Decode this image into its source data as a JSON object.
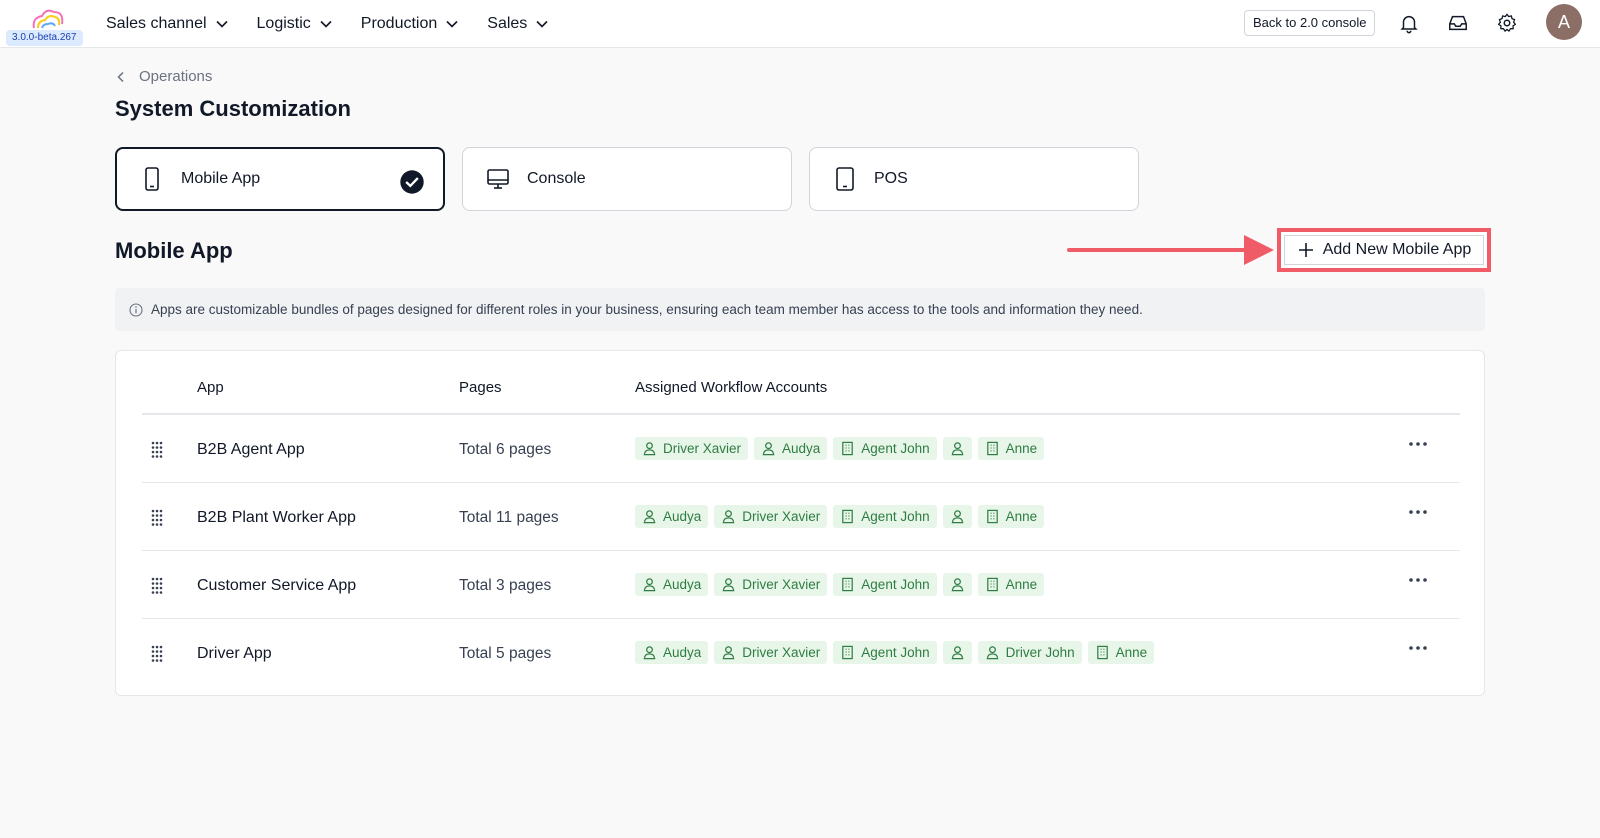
{
  "topbar": {
    "version": "3.0.0-beta.267",
    "nav": [
      {
        "label": "Sales channel"
      },
      {
        "label": "Logistic"
      },
      {
        "label": "Production"
      },
      {
        "label": "Sales"
      }
    ],
    "back_label": "Back to 2.0 console",
    "avatar_initial": "A"
  },
  "breadcrumb": {
    "label": "Operations"
  },
  "page_title": "System Customization",
  "types": [
    {
      "label": "Mobile App",
      "active": true
    },
    {
      "label": "Console",
      "active": false
    },
    {
      "label": "POS",
      "active": false
    }
  ],
  "section": {
    "title": "Mobile App",
    "add_label": "Add New Mobile App",
    "info": "Apps are customizable bundles of pages designed for different roles in your business, ensuring each team member has access to the tools and information they need."
  },
  "table": {
    "headers": {
      "app": "App",
      "pages": "Pages",
      "accounts": "Assigned Workflow Accounts"
    },
    "rows": [
      {
        "app": "B2B Agent App",
        "pages": "Total 6 pages",
        "accounts": [
          {
            "label": "Driver Xavier",
            "kind": "person"
          },
          {
            "label": "Audya",
            "kind": "person"
          },
          {
            "label": "Agent John",
            "kind": "building"
          },
          {
            "label": "",
            "kind": "person"
          },
          {
            "label": "Anne",
            "kind": "building"
          }
        ]
      },
      {
        "app": "B2B Plant Worker App",
        "pages": "Total 11 pages",
        "accounts": [
          {
            "label": "Audya",
            "kind": "person"
          },
          {
            "label": "Driver Xavier",
            "kind": "person"
          },
          {
            "label": "Agent John",
            "kind": "building"
          },
          {
            "label": "",
            "kind": "person"
          },
          {
            "label": "Anne",
            "kind": "building"
          }
        ]
      },
      {
        "app": "Customer Service App",
        "pages": "Total 3 pages",
        "accounts": [
          {
            "label": "Audya",
            "kind": "person"
          },
          {
            "label": "Driver Xavier",
            "kind": "person"
          },
          {
            "label": "Agent John",
            "kind": "building"
          },
          {
            "label": "",
            "kind": "person"
          },
          {
            "label": "Anne",
            "kind": "building"
          }
        ]
      },
      {
        "app": "Driver App",
        "pages": "Total 5 pages",
        "accounts": [
          {
            "label": "Audya",
            "kind": "person"
          },
          {
            "label": "Driver Xavier",
            "kind": "person"
          },
          {
            "label": "Agent John",
            "kind": "building"
          },
          {
            "label": "",
            "kind": "person"
          },
          {
            "label": "Driver John",
            "kind": "person"
          },
          {
            "label": "Anne",
            "kind": "building"
          }
        ]
      }
    ]
  },
  "colors": {
    "accent_red": "#ef5b67",
    "tag_bg": "#e8f5e9",
    "tag_text": "#2e7d43"
  }
}
